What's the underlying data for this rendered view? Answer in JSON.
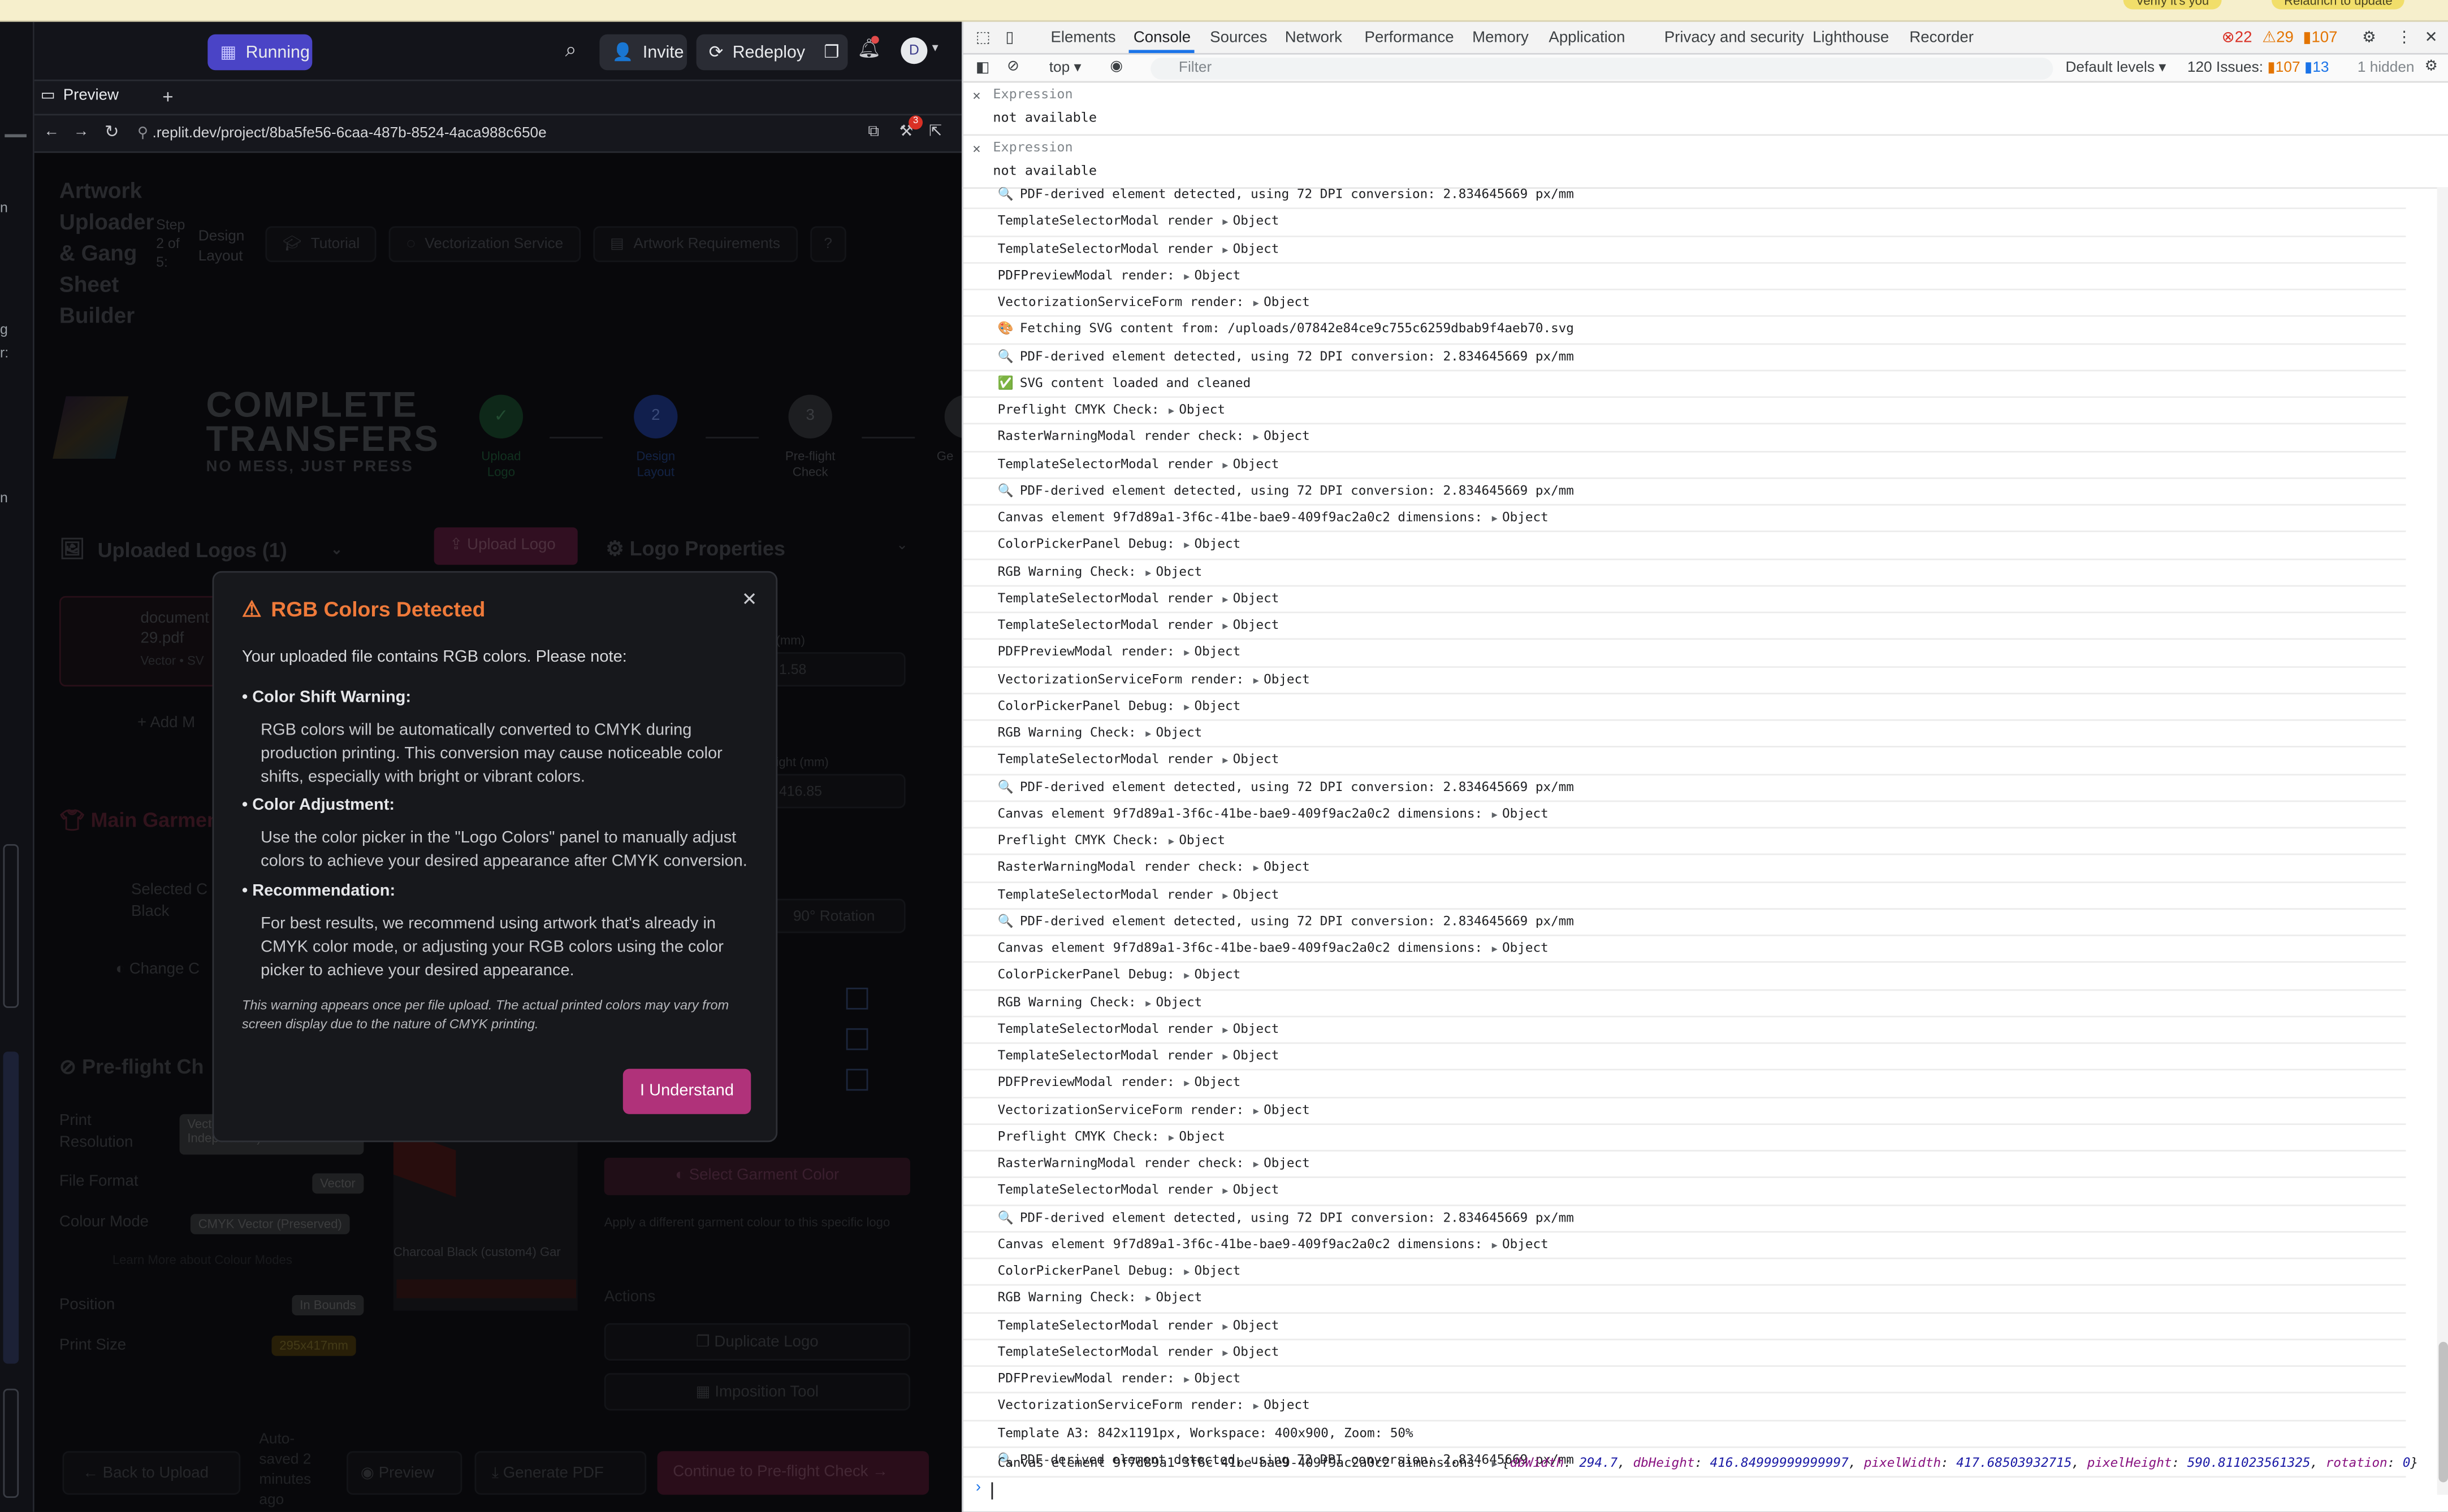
{
  "top_strip": {
    "badge_left": "Verify it's you",
    "badge_right": "Relaunch to update"
  },
  "header": {
    "run_label": "Running",
    "invite_label": "Invite",
    "redeploy_label": "Redeploy",
    "notification_count": "",
    "avatar_letter": "D"
  },
  "tabs": {
    "preview_label": "Preview",
    "add_label": "+"
  },
  "url": {
    "text": ".replit.dev/project/8ba5fe56-6caa-487b-8524-4aca988c650e",
    "badge_count": "3"
  },
  "sidebar_fragments": [
    "n",
    "g",
    "r:",
    "n"
  ],
  "app": {
    "title": "Artwork Uploader & Gang Sheet Builder",
    "step_text": "Step 2 of 5:",
    "step_name": "Design Layout",
    "nav": [
      "Tutorial",
      "Vectorization Service",
      "Artwork Requirements"
    ],
    "logo_line1": "COMPLETE",
    "logo_line2": "TRANSFERS",
    "logo_tagline": "NO MESS, JUST PRESS",
    "steps": [
      {
        "num": "✓",
        "label": "Upload Logo"
      },
      {
        "num": "2",
        "label": "Design Layout"
      },
      {
        "num": "3",
        "label": "Pre-flight Check"
      },
      {
        "num": "4",
        "label": "Ge"
      }
    ],
    "uploaded_title": "Uploaded Logos (1)",
    "upload_btn": "Upload Logo",
    "file_name": "document 29.pdf",
    "file_meta": "Vector • SV",
    "add_more": "Add M",
    "garment_title": "Main Garmen",
    "selected_label": "Selected C",
    "selected_value": "Black",
    "change_btn": "Change C",
    "preflight_title": "Pre-flight Ch",
    "preflight": [
      {
        "label": "Print Resolution",
        "value": "Vector (Resolution Independent)"
      },
      {
        "label": "File Format",
        "value": "Vector"
      },
      {
        "label": "Colour Mode",
        "value": "CMYK Vector (Preserved)"
      },
      {
        "label": "Position",
        "value": "In Bounds"
      },
      {
        "label": "Print Size",
        "value": "295x417mm"
      }
    ],
    "learn_more": "Learn More about Colour Modes",
    "props_title": "Logo Properties",
    "width_label": "(mm)",
    "width_value": "1.58",
    "height_label": "ight (mm)",
    "height_value": "416.85",
    "rotation_btn": "90° Rotation",
    "canvas_caption": "Charcoal Black (custom4) Gar",
    "select_garment_btn": "Select Garment Color",
    "garment_help": "Apply a different garment colour to this specific logo",
    "actions_title": "Actions",
    "duplicate_btn": "Duplicate Logo",
    "imposition_btn": "Imposition Tool",
    "back_btn": "Back to Upload",
    "autosave": "Auto-saved 2 minutes ago",
    "preview_btn": "Preview",
    "generate_btn": "Generate PDF",
    "continue_btn": "Continue to Pre-flight Check"
  },
  "modal": {
    "title": "RGB Colors Detected",
    "intro": "Your uploaded file contains RGB colors. Please note:",
    "sections": [
      {
        "heading": "• Color Shift Warning:",
        "body": "RGB colors will be automatically converted to CMYK during production printing. This conversion may cause noticeable color shifts, especially with bright or vibrant colors."
      },
      {
        "heading": "• Color Adjustment:",
        "body": "Use the color picker in the \"Logo Colors\" panel to manually adjust colors to achieve your desired appearance after CMYK conversion."
      },
      {
        "heading": "• Recommendation:",
        "body": "For best results, we recommend using artwork that's already in CMYK color mode, or adjusting your RGB colors using the color picker to achieve your desired appearance."
      }
    ],
    "note": "This warning appears once per file upload. The actual printed colors may vary from screen display due to the nature of CMYK printing.",
    "button": "I Understand"
  },
  "devtools": {
    "tabs": [
      "Elements",
      "Console",
      "Sources",
      "Network",
      "Performance",
      "Memory",
      "Application",
      "Privacy and security",
      "Lighthouse",
      "Recorder"
    ],
    "errors": "22",
    "warnings": "29",
    "issues_count": "107",
    "context": "top",
    "filter_placeholder": "Filter",
    "levels": "Default levels",
    "issues_text": "120 Issues:",
    "issues_a": "107",
    "issues_b": "13",
    "hidden": "1 hidden",
    "expressions": [
      {
        "label": "Expression",
        "value": "not available"
      },
      {
        "label": "Expression",
        "value": "not available"
      }
    ],
    "logs": [
      {
        "prefix": "🔍",
        "text": "PDF-derived element detected, using 72 DPI conversion: 2.834645669 px/mm",
        "obj": ""
      },
      {
        "prefix": "",
        "text": "TemplateSelectorModal render",
        "obj": "Object"
      },
      {
        "prefix": "",
        "text": "TemplateSelectorModal render",
        "obj": "Object"
      },
      {
        "prefix": "",
        "text": "PDFPreviewModal render:",
        "obj": "Object"
      },
      {
        "prefix": "",
        "text": "VectorizationServiceForm render:",
        "obj": "Object"
      },
      {
        "prefix": "🎨",
        "text": "Fetching SVG content from: /uploads/07842e84ce9c755c6259dbab9f4aeb70.svg",
        "obj": ""
      },
      {
        "prefix": "🔍",
        "text": "PDF-derived element detected, using 72 DPI conversion: 2.834645669 px/mm",
        "obj": ""
      },
      {
        "prefix": "✅",
        "text": "SVG content loaded and cleaned",
        "obj": ""
      },
      {
        "prefix": "",
        "text": "Preflight CMYK Check:",
        "obj": "Object"
      },
      {
        "prefix": "",
        "text": "RasterWarningModal render check:",
        "obj": "Object"
      },
      {
        "prefix": "",
        "text": "TemplateSelectorModal render",
        "obj": "Object"
      },
      {
        "prefix": "🔍",
        "text": "PDF-derived element detected, using 72 DPI conversion: 2.834645669 px/mm",
        "obj": ""
      },
      {
        "prefix": "",
        "text": "Canvas element 9f7d89a1-3f6c-41be-bae9-409f9ac2a0c2 dimensions:",
        "obj": "Object"
      },
      {
        "prefix": "",
        "text": "ColorPickerPanel Debug:",
        "obj": "Object"
      },
      {
        "prefix": "",
        "text": "RGB Warning Check:",
        "obj": "Object"
      },
      {
        "prefix": "",
        "text": "TemplateSelectorModal render",
        "obj": "Object"
      },
      {
        "prefix": "",
        "text": "TemplateSelectorModal render",
        "obj": "Object"
      },
      {
        "prefix": "",
        "text": "PDFPreviewModal render:",
        "obj": "Object"
      },
      {
        "prefix": "",
        "text": "VectorizationServiceForm render:",
        "obj": "Object"
      },
      {
        "prefix": "",
        "text": "ColorPickerPanel Debug:",
        "obj": "Object"
      },
      {
        "prefix": "",
        "text": "RGB Warning Check:",
        "obj": "Object"
      },
      {
        "prefix": "",
        "text": "TemplateSelectorModal render",
        "obj": "Object"
      },
      {
        "prefix": "🔍",
        "text": "PDF-derived element detected, using 72 DPI conversion: 2.834645669 px/mm",
        "obj": ""
      },
      {
        "prefix": "",
        "text": "Canvas element 9f7d89a1-3f6c-41be-bae9-409f9ac2a0c2 dimensions:",
        "obj": "Object"
      },
      {
        "prefix": "",
        "text": "Preflight CMYK Check:",
        "obj": "Object"
      },
      {
        "prefix": "",
        "text": "RasterWarningModal render check:",
        "obj": "Object"
      },
      {
        "prefix": "",
        "text": "TemplateSelectorModal render",
        "obj": "Object"
      },
      {
        "prefix": "🔍",
        "text": "PDF-derived element detected, using 72 DPI conversion: 2.834645669 px/mm",
        "obj": ""
      },
      {
        "prefix": "",
        "text": "Canvas element 9f7d89a1-3f6c-41be-bae9-409f9ac2a0c2 dimensions:",
        "obj": "Object"
      },
      {
        "prefix": "",
        "text": "ColorPickerPanel Debug:",
        "obj": "Object"
      },
      {
        "prefix": "",
        "text": "RGB Warning Check:",
        "obj": "Object"
      },
      {
        "prefix": "",
        "text": "TemplateSelectorModal render",
        "obj": "Object"
      },
      {
        "prefix": "",
        "text": "TemplateSelectorModal render",
        "obj": "Object"
      },
      {
        "prefix": "",
        "text": "PDFPreviewModal render:",
        "obj": "Object"
      },
      {
        "prefix": "",
        "text": "VectorizationServiceForm render:",
        "obj": "Object"
      },
      {
        "prefix": "",
        "text": "Preflight CMYK Check:",
        "obj": "Object"
      },
      {
        "prefix": "",
        "text": "RasterWarningModal render check:",
        "obj": "Object"
      },
      {
        "prefix": "",
        "text": "TemplateSelectorModal render",
        "obj": "Object"
      },
      {
        "prefix": "🔍",
        "text": "PDF-derived element detected, using 72 DPI conversion: 2.834645669 px/mm",
        "obj": ""
      },
      {
        "prefix": "",
        "text": "Canvas element 9f7d89a1-3f6c-41be-bae9-409f9ac2a0c2 dimensions:",
        "obj": "Object"
      },
      {
        "prefix": "",
        "text": "ColorPickerPanel Debug:",
        "obj": "Object"
      },
      {
        "prefix": "",
        "text": "RGB Warning Check:",
        "obj": "Object"
      },
      {
        "prefix": "",
        "text": "TemplateSelectorModal render",
        "obj": "Object"
      },
      {
        "prefix": "",
        "text": "TemplateSelectorModal render",
        "obj": "Object"
      },
      {
        "prefix": "",
        "text": "PDFPreviewModal render:",
        "obj": "Object"
      },
      {
        "prefix": "",
        "text": "VectorizationServiceForm render:",
        "obj": "Object"
      },
      {
        "prefix": "",
        "text": "Template A3: 842x1191px, Workspace: 400x900, Zoom: 50%",
        "obj": ""
      },
      {
        "prefix": "🔍",
        "text": "PDF-derived element detected, using 72 DPI conversion: 2.834645669 px/mm",
        "obj": ""
      }
    ],
    "last_log": {
      "text": "Canvas element 9f7d89a1-3f6c-41be-bae9-409f9ac2a0c2 dimensions:",
      "props": [
        {
          "k": "dbWidth",
          "v": "294.7"
        },
        {
          "k": "dbHeight",
          "v": "416.84999999999997"
        },
        {
          "k": "pixelWidth",
          "v": "417.68503932715"
        },
        {
          "k": "pixelHeight",
          "v": "590.811023561325"
        },
        {
          "k": "rotation",
          "v": "0"
        }
      ]
    }
  }
}
